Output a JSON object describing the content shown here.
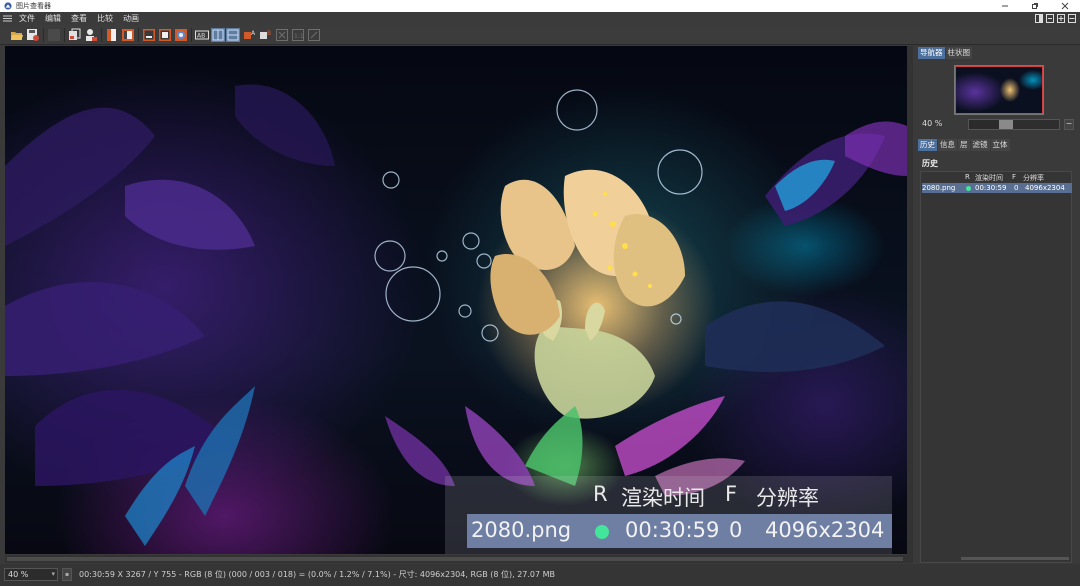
{
  "window": {
    "title": "图片查看器"
  },
  "menu": [
    "文件",
    "编辑",
    "查看",
    "比较",
    "动画"
  ],
  "image": {
    "overlay": {
      "headers": {
        "r": "R",
        "render_time": "渲染时间",
        "f": "F",
        "resolution": "分辨率"
      },
      "row": {
        "name": "2080.png",
        "time": "00:30:59",
        "f": "0",
        "resolution": "4096x2304"
      }
    }
  },
  "panel": {
    "top_tabs": [
      "导航器",
      "柱状图"
    ],
    "zoom_label": "40 %",
    "zoom_level_percent": 40,
    "zoom_minus": "−",
    "lower_tabs": [
      "历史",
      "信息",
      "层",
      "滤镜",
      "立体"
    ],
    "section_title": "历史",
    "history_headers": {
      "r": "R",
      "render_time": "渲染时间",
      "f": "F",
      "resolution": "分辨率"
    },
    "history_rows": [
      {
        "name": "2080.png",
        "status_color": "#43e59a",
        "time": "00:30:59",
        "f": "0",
        "resolution": "4096x2304"
      }
    ]
  },
  "status": {
    "zoom_value": "40 %",
    "text": "00:30:59    X 3267 / Y 755 - RGB (8 位) (000 / 003 / 018) = (0.0% / 1.2% / 7.1%) - 尺寸: 4096x2304, RGB (8 位), 27.07 MB"
  },
  "colors": {
    "accent": "#4d6f9c",
    "selection": "#586f92",
    "status_dot": "#43e59a"
  }
}
